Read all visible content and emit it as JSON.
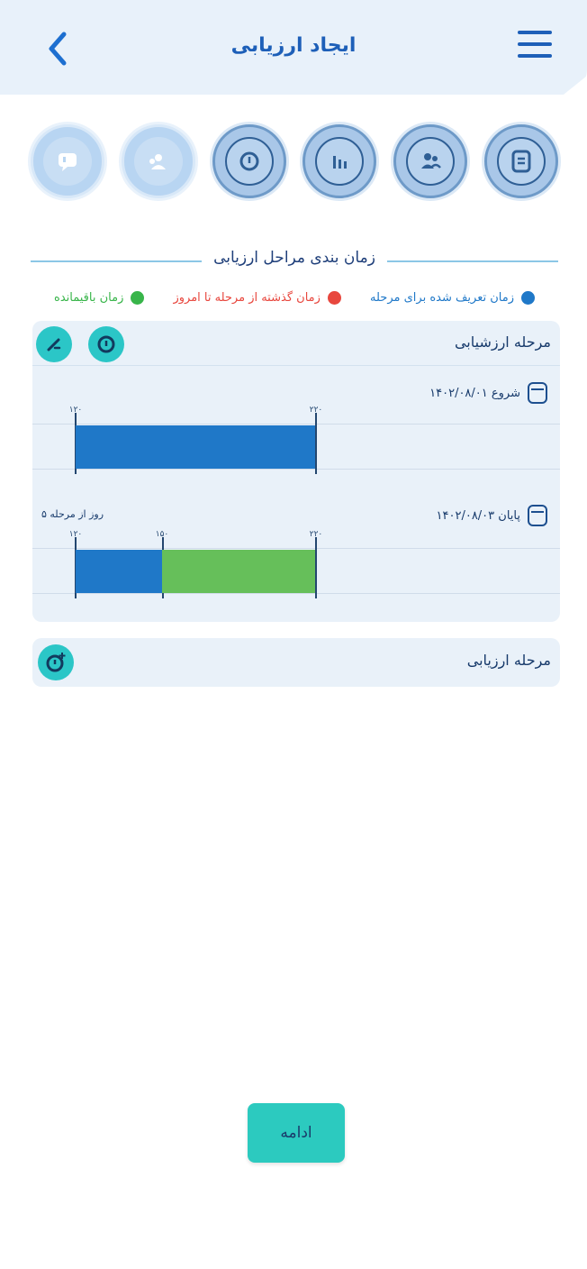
{
  "header": {
    "title": "ایجاد ارزیابی",
    "back_icon": "chevron-left-icon",
    "menu_icon": "hamburger-menu-icon"
  },
  "steps": [
    {
      "icon": "document-list-icon",
      "state": "done"
    },
    {
      "icon": "users-icon",
      "state": "done"
    },
    {
      "icon": "bar-chart-icon",
      "state": "done"
    },
    {
      "icon": "clock-icon",
      "state": "current"
    },
    {
      "icon": "user-group-icon",
      "state": "pending"
    },
    {
      "icon": "chat-icon",
      "state": "pending"
    }
  ],
  "section": {
    "title": "زمان بندی مراحل ارزیابی"
  },
  "legend": [
    {
      "label": "زمان تعریف شده برای مرحله",
      "color": "#1f78c8"
    },
    {
      "label": "زمان گذشته از مرحله تا امروز",
      "color": "#e8473e"
    },
    {
      "label": "زمان باقیمانده",
      "color": "#38b54a"
    }
  ],
  "stages": [
    {
      "title": "مرحله ارزشیابی",
      "action_icons": [
        "clock-icon",
        "edit-icon"
      ],
      "rows": [
        {
          "label": "شروع ۱۴۰۲/۰۸/۰۱",
          "tick_start": "۱۲۰",
          "tick_end": "۲۲۰",
          "segments": [
            {
              "color": "#1f78c8",
              "from": 0,
              "to": 1
            }
          ]
        },
        {
          "label": "پایان ۱۴۰۲/۰۸/۰۳",
          "over_label": "۵ روز از مرحله",
          "tick_start": "۱۲۰",
          "tick_mid": "۱۵۰",
          "tick_end": "۲۲۰",
          "segments": [
            {
              "color": "#1f78c8",
              "from": 0,
              "to": 0.36
            },
            {
              "color": "#66bf5a",
              "from": 0.36,
              "to": 1
            }
          ]
        }
      ]
    },
    {
      "title": "مرحله ارزیابی",
      "action_icons": [
        "clock-add-icon"
      ]
    }
  ],
  "footer": {
    "next_label": "ادامه"
  }
}
